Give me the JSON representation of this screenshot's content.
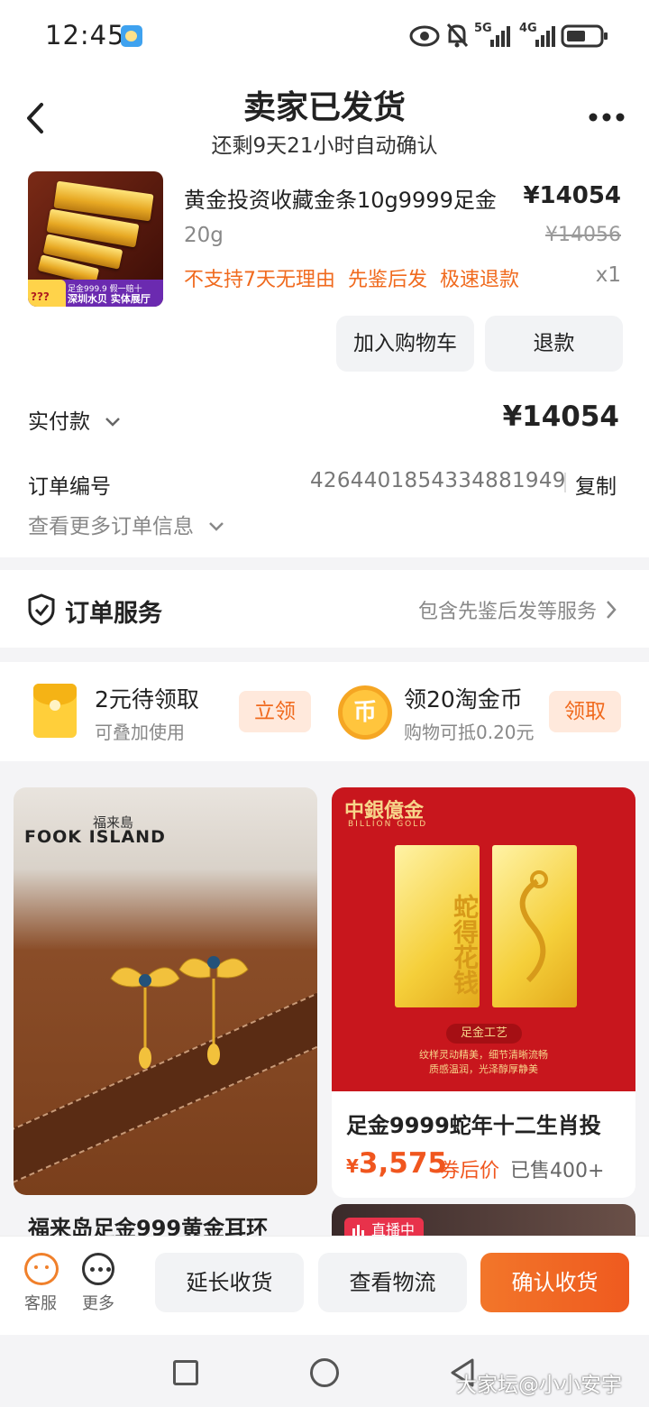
{
  "status_bar": {
    "time": "12:45",
    "net1": "5G",
    "net2": "4G"
  },
  "header": {
    "title": "卖家已发货",
    "subtitle": "还剩9天21小时自动确认"
  },
  "product": {
    "name": "黄金投资收藏金条10g9999足金",
    "price": "¥14054",
    "spec": "20g",
    "original_price": "¥14056",
    "tags": [
      "不支持7天无理由",
      "先鉴后发",
      "极速退款"
    ],
    "qty": "x1",
    "thumb_text_a": "足金999.9 假一赔十",
    "thumb_text_b": "深圳水贝 实体展厅",
    "thumb_text_c": "???"
  },
  "actions": {
    "add_cart": "加入购物车",
    "refund": "退款"
  },
  "payment": {
    "label": "实付款",
    "value": "¥14054"
  },
  "order": {
    "label": "订单编号",
    "number": "4264401854334881949",
    "copy": "复制",
    "more": "查看更多订单信息"
  },
  "service": {
    "label": "订单服务",
    "detail": "包含先鉴后发等服务"
  },
  "coupons": [
    {
      "title": "2元待领取",
      "sub": "可叠加使用",
      "button": "立领"
    },
    {
      "title": "领20淘金币",
      "sub": "购物可抵0.20元",
      "button": "领取",
      "icon_char": "币"
    }
  ],
  "feed": {
    "left": {
      "brand_cn": "福来島",
      "brand_en": "FOOK ISLAND",
      "title": "福来岛足金999黄金耳环"
    },
    "right": {
      "brand": "中銀億金",
      "brand_sub": "BILLION GOLD",
      "bar_text": "蛇得花钱",
      "badge": "足金工艺",
      "desc1": "纹样灵动精美，细节清晰流畅",
      "desc2": "质感温润，光泽醇厚静美",
      "title": "足金9999蛇年十二生肖投",
      "price_symbol": "¥",
      "price": "3,575",
      "coupon": "券后价",
      "sold": "已售400+"
    },
    "live_badge": "直播中"
  },
  "bottom_bar": {
    "cs": "客服",
    "more": "更多",
    "extend": "延长收货",
    "logistics": "查看物流",
    "confirm": "确认收货"
  },
  "watermark": "大家坛@小小安宇",
  "colors": {
    "accent": "#F06A1E",
    "confirm": "#EF5A1F"
  }
}
